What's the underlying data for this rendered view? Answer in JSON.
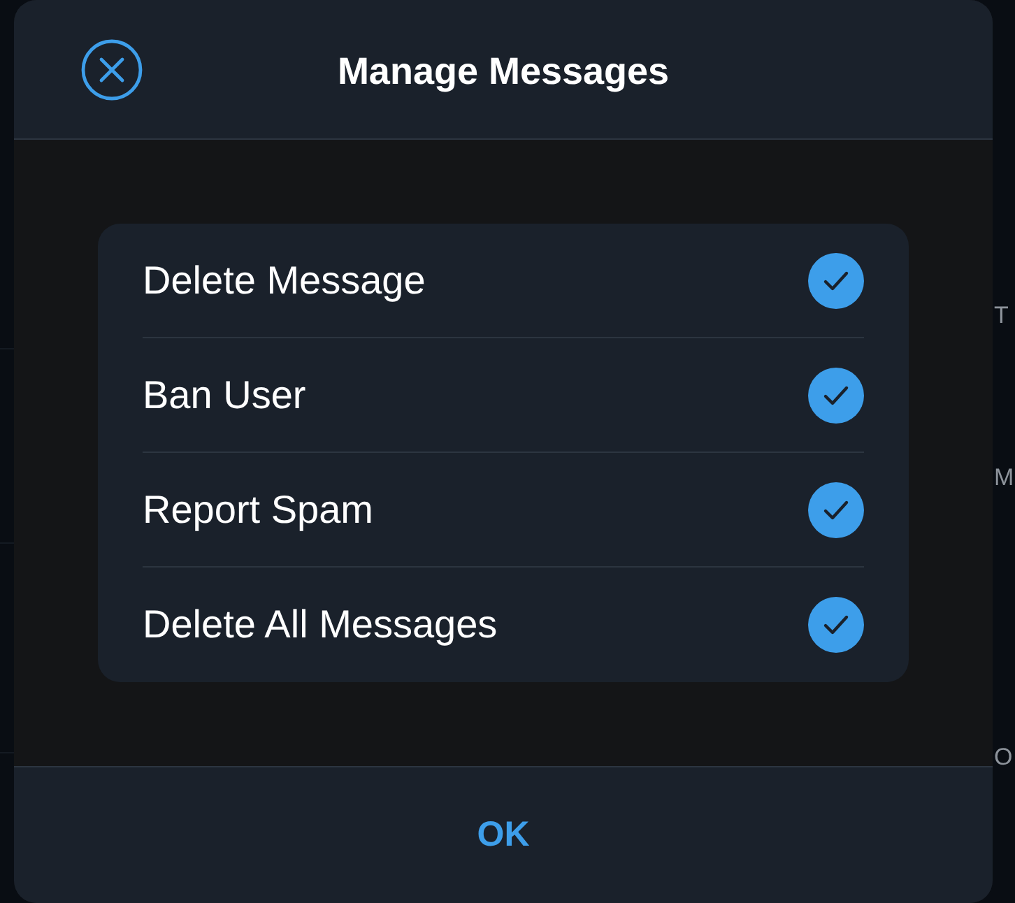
{
  "background": {
    "edge_texts": [
      "T",
      "M",
      "O"
    ]
  },
  "dialog": {
    "title": "Manage Messages",
    "items": [
      {
        "label": "Delete Message",
        "checked": true
      },
      {
        "label": "Ban User",
        "checked": true
      },
      {
        "label": "Report Spam",
        "checked": true
      },
      {
        "label": "Delete All Messages",
        "checked": true
      }
    ],
    "confirm_button": "OK"
  }
}
